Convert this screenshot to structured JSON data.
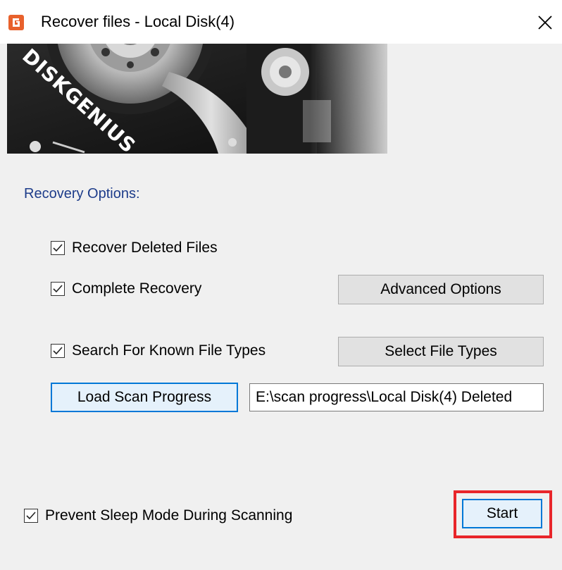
{
  "window": {
    "title": "Recover files - Local Disk(4)",
    "app_icon": "diskgenius-app-icon",
    "close_icon": "close-icon"
  },
  "banner": {
    "brand_text": "DISKGENIUS"
  },
  "options": {
    "section_label": "Recovery Options:",
    "recover_deleted": {
      "label": "Recover Deleted Files",
      "checked": true
    },
    "complete_recovery": {
      "label": "Complete Recovery",
      "checked": true
    },
    "search_known_types": {
      "label": "Search For Known File Types",
      "checked": true
    }
  },
  "buttons": {
    "advanced_options": "Advanced Options",
    "select_file_types": "Select File Types",
    "load_scan_progress": "Load Scan Progress",
    "start": "Start"
  },
  "scan_progress_path": {
    "value": "E:\\scan progress\\Local Disk(4) Deleted"
  },
  "footer": {
    "prevent_sleep": {
      "label": "Prevent Sleep Mode During Scanning",
      "checked": true
    }
  },
  "colors": {
    "accent_blue": "#0078d7",
    "section_label": "#1d3c8a",
    "highlight_red": "#e8252a",
    "app_icon_orange": "#e8612c"
  }
}
